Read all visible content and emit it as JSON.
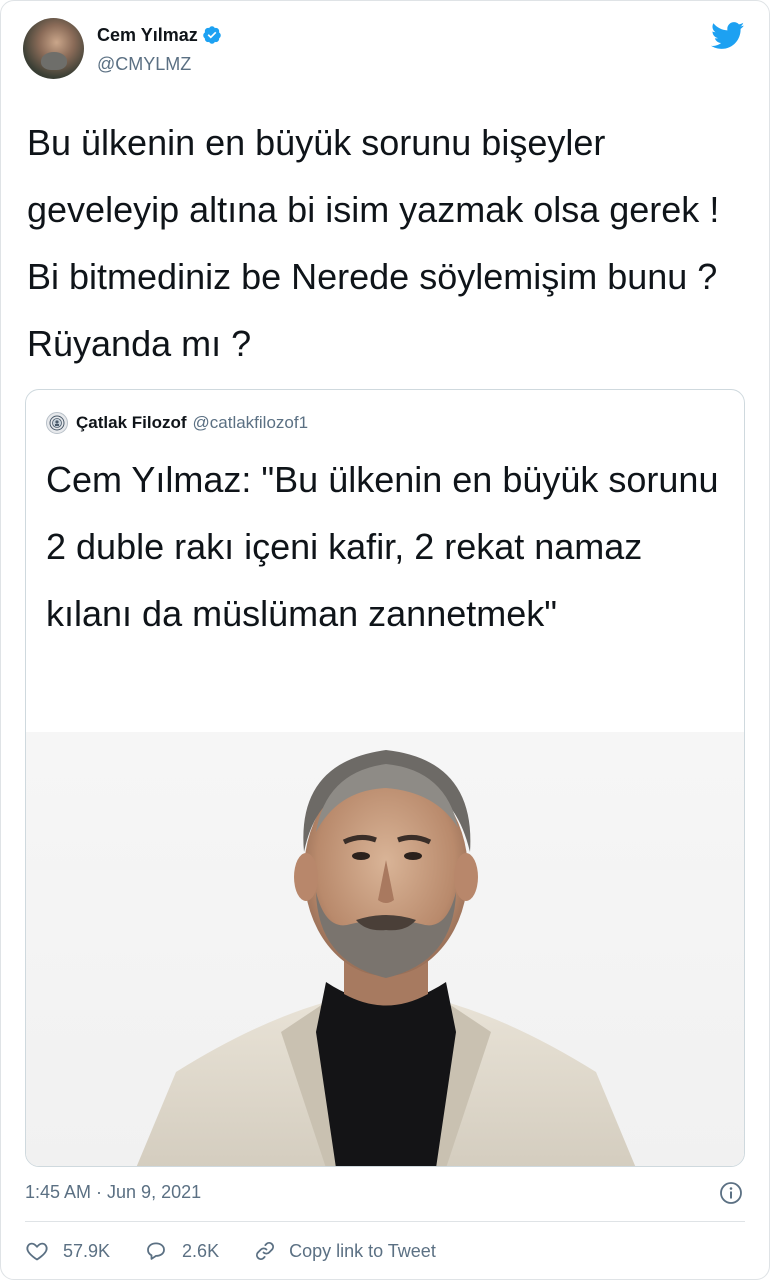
{
  "author": {
    "display_name": "Cem Yılmaz",
    "handle": "@CMYLMZ",
    "avatar_icon": "profile-photo"
  },
  "tweet": {
    "text": "Bu ülkenin en büyük sorunu bişeyler geveleyip altına bi isim yazmak olsa gerek ! Bi bitmediniz be Nerede söylemişim bunu ? Rüyanda mı ?"
  },
  "quoted_tweet": {
    "author_name": "Çatlak Filozof",
    "author_handle": "@catlakfilozof1",
    "text": "Cem Yılmaz: \"Bu ülkenin en büyük sorunu 2 duble rakı içeni kafir, 2 rekat namaz kılanı da müslüman zannetmek\"",
    "image": "portrait-photo"
  },
  "meta": {
    "timestamp": "1:45 AM · Jun 9, 2021"
  },
  "actions": {
    "likes": "57.9K",
    "replies": "2.6K",
    "copy_link_label": "Copy link to Tweet"
  },
  "colors": {
    "brand_blue": "#1da1f2",
    "secondary_text": "#5b7083",
    "border": "#cfd9de"
  }
}
